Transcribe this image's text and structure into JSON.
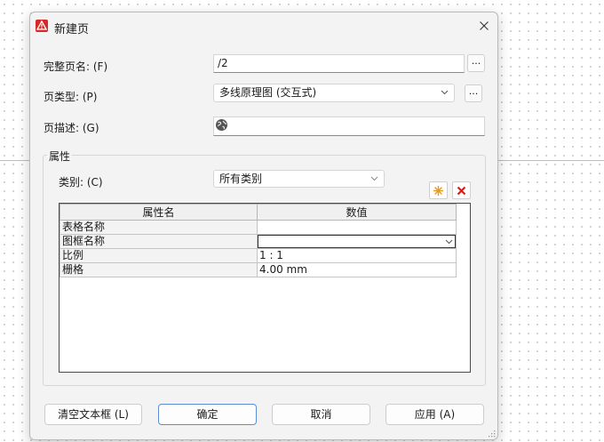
{
  "dialog": {
    "title": "新建页"
  },
  "form": {
    "full_name_label": "完整页名: (F)",
    "full_name_value": "/2",
    "browse_btn": "...",
    "page_type_label": "页类型: (P)",
    "page_type_value": "多线原理图 (交互式)",
    "page_type_btn": "...",
    "desc_label": "页描述: (G)",
    "desc_value": ""
  },
  "properties": {
    "group_title": "属性",
    "category_label": "类别: (C)",
    "category_value": "所有类别",
    "columns": {
      "name": "属性名",
      "value": "数值"
    },
    "rows": [
      {
        "name": "表格名称",
        "value": ""
      },
      {
        "name": "图框名称",
        "value": ""
      },
      {
        "name": "比例",
        "value": "1 : 1"
      },
      {
        "name": "栅格",
        "value": "4.00 mm"
      }
    ]
  },
  "buttons": {
    "clear": "清空文本框 (L)",
    "ok": "确定",
    "cancel": "取消",
    "apply": "应用 (A)"
  }
}
